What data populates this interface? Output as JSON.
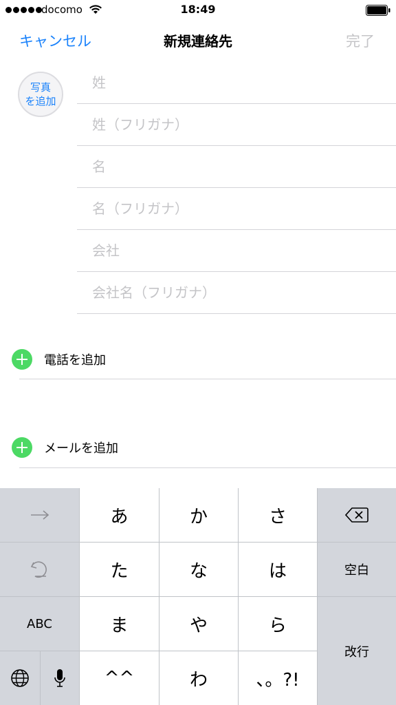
{
  "status_bar": {
    "carrier": "docomo",
    "time": "18:49"
  },
  "nav": {
    "cancel_label": "キャンセル",
    "title": "新規連絡先",
    "done_label": "完了"
  },
  "photo": {
    "line1": "写真",
    "line2": "を追加"
  },
  "fields": [
    {
      "placeholder": "姓"
    },
    {
      "placeholder": "姓（フリガナ）"
    },
    {
      "placeholder": "名"
    },
    {
      "placeholder": "名（フリガナ）"
    },
    {
      "placeholder": "会社"
    },
    {
      "placeholder": "会社名（フリガナ）"
    }
  ],
  "add_phone": {
    "label": "電話を追加"
  },
  "add_email": {
    "label": "メールを追加"
  },
  "keyboard": {
    "keys": {
      "a": "あ",
      "ka": "か",
      "sa": "さ",
      "ta": "た",
      "na": "な",
      "ha": "は",
      "ma": "ま",
      "ya": "や",
      "ra": "ら",
      "emoticon": "^^",
      "wa": "わ",
      "punct": "、。?!",
      "abc": "ABC",
      "space": "空白",
      "return": "改行"
    }
  },
  "colors": {
    "tint": "#1a82fb",
    "disabled": "#c4c4c7",
    "add_green": "#4cd964",
    "keyboard_bg": "#d3d6dc"
  }
}
